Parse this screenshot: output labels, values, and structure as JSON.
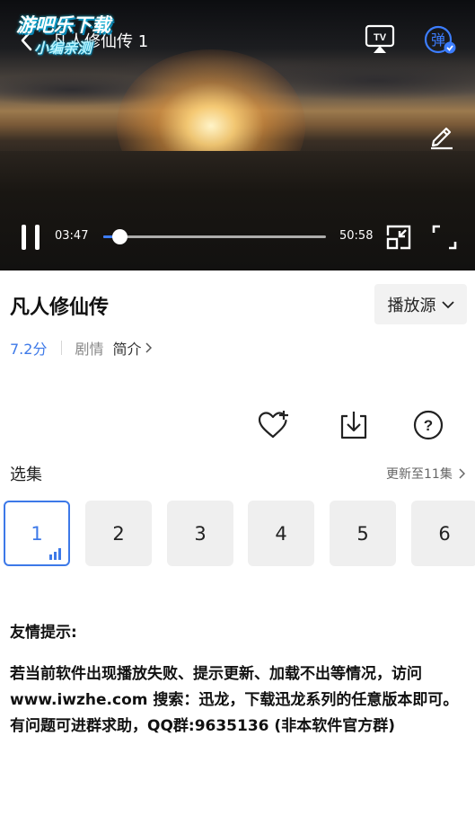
{
  "player": {
    "watermark_line1": "游吧乐下载",
    "watermark_line2": "小编亲测",
    "title": "凡人修仙传 1",
    "current_time": "03:47",
    "total_time": "50:58",
    "progress_fraction": 0.0715,
    "accent_color": "#3c7dff",
    "icons": [
      "back-icon",
      "tv-cast-icon",
      "danmu-icon",
      "edit-icon",
      "pause-icon",
      "pip-icon",
      "fullscreen-icon"
    ]
  },
  "info": {
    "title": "凡人修仙传",
    "source_button": "播放源",
    "rating": "7.2分",
    "genre": "剧情",
    "intro_link": "简介",
    "rating_color": "#3d79e8"
  },
  "episodes": {
    "label": "选集",
    "update_info": "更新至11集",
    "items": [
      "1",
      "2",
      "3",
      "4",
      "5",
      "6"
    ],
    "active_index": 0
  },
  "notice": {
    "title": "友情提示:",
    "body": "若当前软件出现播放失败、提示更新、加载不出等情况，访问 www.iwzhe.com 搜索：迅龙，下载迅龙系列的任意版本即可。有问题可进群求助，QQ群:9635136 (非本软件官方群)"
  }
}
